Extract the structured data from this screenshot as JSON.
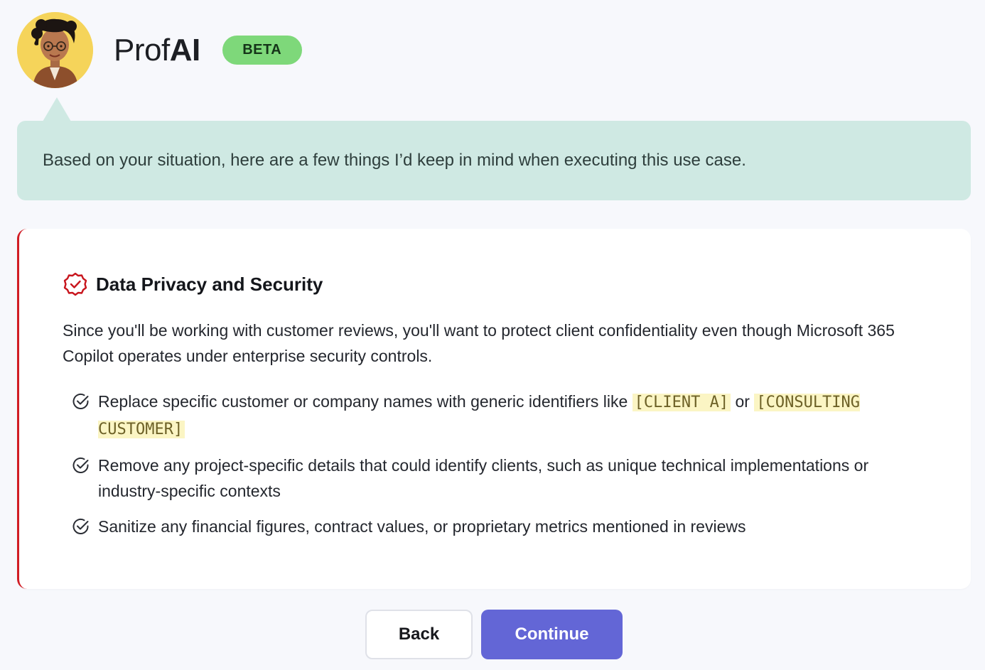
{
  "header": {
    "brand_prefix": "Prof",
    "brand_suffix": "AI",
    "badge": "BETA"
  },
  "speech": {
    "text": "Based on your situation, here are a few things I’d keep in mind when executing this use case."
  },
  "card": {
    "title": "Data Privacy and Security",
    "intro": "Since you'll be working with customer reviews, you'll want to protect client confidentiality even though Microsoft 365 Copilot operates under enterprise security controls.",
    "bullets": [
      {
        "pre": "Replace specific customer or company names with generic identifiers like ",
        "code1": "[CLIENT A]",
        "mid": " or ",
        "code2": "[CONSULTING CUSTOMER]"
      },
      {
        "text": "Remove any project-specific details that could identify clients, such as unique technical implementations or industry-specific contexts"
      },
      {
        "text": "Sanitize any financial figures, contract values, or proprietary metrics mentioned in reviews"
      }
    ]
  },
  "buttons": {
    "back": "Back",
    "continue": "Continue"
  },
  "colors": {
    "accent": "#6366d6",
    "badge": "#7ed87a",
    "speech_bg": "#cfe9e3",
    "warning": "#d11c24",
    "highlight": "#fbf5c4"
  },
  "icons": {
    "title": "badge-check-icon",
    "bullet": "check-circle-icon"
  }
}
